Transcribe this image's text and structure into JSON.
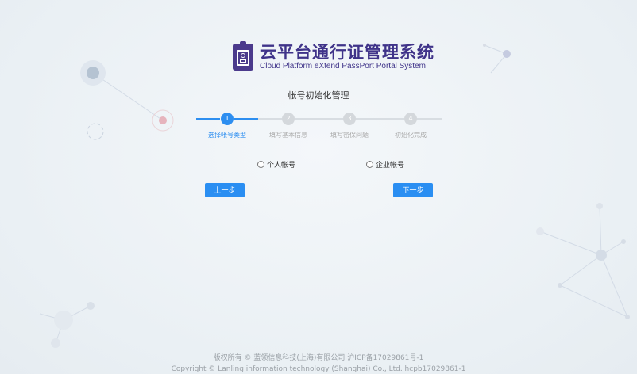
{
  "header": {
    "title_cn": "云平台通行证管理系统",
    "title_en": "Cloud Platform eXtend PassPort Portal System"
  },
  "page_title": "帐号初始化管理",
  "steps": [
    {
      "number": "1",
      "label": "选择帐号类型",
      "active": true
    },
    {
      "number": "2",
      "label": "填写基本信息",
      "active": false
    },
    {
      "number": "3",
      "label": "填写密保问题",
      "active": false
    },
    {
      "number": "4",
      "label": "初始化完成",
      "active": false
    }
  ],
  "account_types": {
    "personal": "个人帐号",
    "enterprise": "企业帐号"
  },
  "buttons": {
    "prev": "上一步",
    "next": "下一步"
  },
  "footer": {
    "line1": "版权所有 © 蓝领信息科技(上海)有限公司 沪ICP备17029861号-1",
    "line2": "Copyright © Lanling information technology (Shanghai) Co., Ltd. hcpb17029861-1"
  },
  "colors": {
    "brand": "#3f3389",
    "accent": "#2d8ef0",
    "inactive": "#d4d8dc"
  },
  "icons": {
    "logo": "badge-icon"
  }
}
